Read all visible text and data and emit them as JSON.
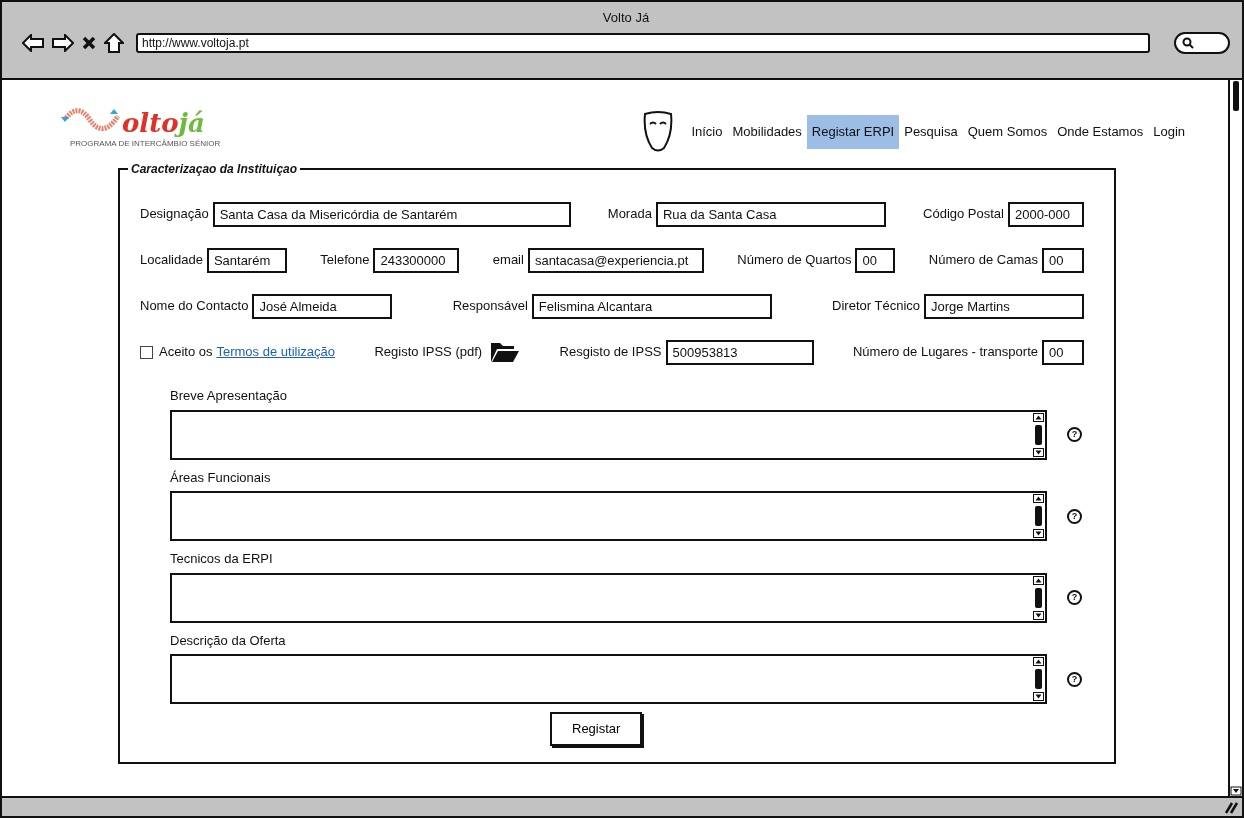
{
  "window": {
    "title": "Volto Já",
    "url": "http://www.voltoja.pt"
  },
  "logo": {
    "word": "olto",
    "accent": "já",
    "tagline": "PROGRAMA DE INTERCÂMBIO SÉNIOR"
  },
  "nav": [
    {
      "label": "Início",
      "selected": false
    },
    {
      "label": "Mobilidades",
      "selected": false
    },
    {
      "label": "Registar ERPI",
      "selected": true
    },
    {
      "label": "Pesquisa",
      "selected": false
    },
    {
      "label": "Quem Somos",
      "selected": false
    },
    {
      "label": "Onde Estamos",
      "selected": false
    },
    {
      "label": "Login",
      "selected": false
    }
  ],
  "form": {
    "legend": "Caracterizaçao da Instituiçao",
    "rows": [
      [
        {
          "kind": "field",
          "label": "Designação",
          "value": "Santa Casa da Misericórdia de Santarém"
        },
        {
          "kind": "field",
          "label": "Morada",
          "value": "Rua da Santa Casa"
        },
        {
          "kind": "field",
          "label": "Código Postal",
          "value": "2000-000"
        }
      ],
      [
        {
          "kind": "field",
          "label": "Localidade",
          "value": "Santarém"
        },
        {
          "kind": "field",
          "label": "Telefone",
          "value": "243300000"
        },
        {
          "kind": "field",
          "label": "email",
          "value": "santacasa@experiencia.pt"
        },
        {
          "kind": "field",
          "label": "Número de Quartos",
          "value": "00"
        },
        {
          "kind": "field",
          "label": "Número de Camas",
          "value": "00"
        }
      ],
      [
        {
          "kind": "field",
          "label": "Nome do Contacto",
          "value": "José Almeida"
        },
        {
          "kind": "field",
          "label": "Responsável",
          "value": "Felismina Alcantara"
        },
        {
          "kind": "field",
          "label": "Diretor Técnico",
          "value": "Jorge Martins"
        }
      ],
      [
        {
          "kind": "checkbox",
          "label": "Aceito os",
          "link": "Termos de utilização",
          "checked": false
        },
        {
          "kind": "upload",
          "label": "Registo IPSS (pdf)"
        },
        {
          "kind": "field",
          "label": "Resgisto de IPSS",
          "value": "500953813"
        },
        {
          "kind": "field",
          "label": "Número de Lugares - transporte",
          "value": "00"
        }
      ]
    ]
  },
  "text_areas": [
    {
      "label": "Breve Apresentação",
      "help": "?"
    },
    {
      "label": "Áreas Funcionais",
      "help": "?"
    },
    {
      "label": "Tecnicos da ERPI",
      "help": "?"
    },
    {
      "label": "Descrição da Oferta",
      "help": "?"
    }
  ],
  "submit": "Registar"
}
